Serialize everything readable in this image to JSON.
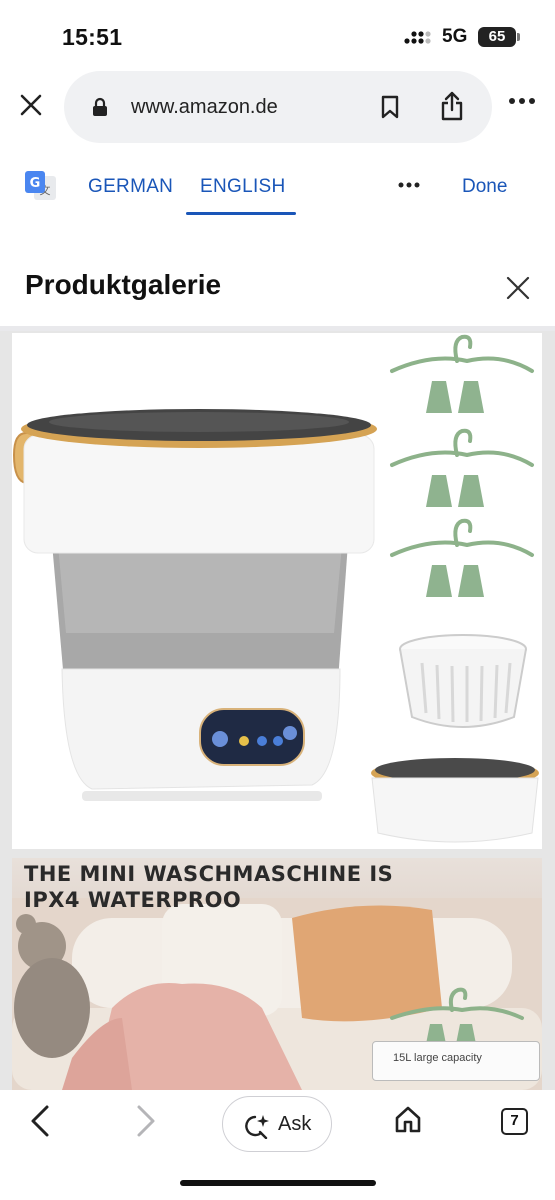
{
  "status_bar": {
    "time": "15:51",
    "network": "5G",
    "battery": "65",
    "icons": [
      "signal-icon",
      "battery-icon"
    ]
  },
  "browser": {
    "url": "www.amazon.de",
    "icons": [
      "close-icon",
      "lock-icon",
      "bookmark-icon",
      "share-icon",
      "more-icon"
    ]
  },
  "translate": {
    "source_lang": "GERMAN",
    "target_lang": "ENGLISH",
    "done_label": "Done",
    "active_tab": "ENGLISH",
    "accent_color": "#1a56b8",
    "icons": [
      "google-translate-icon",
      "more-icon"
    ]
  },
  "gallery": {
    "title": "Produktgalerie",
    "images": [
      {
        "alt": ""
      },
      {
        "heading_line1": "THE MINI WASCHMASCHINE IS",
        "heading_line2": "IPX4 WATERPROO",
        "capacity_label": "15L large capacity"
      }
    ],
    "icons": [
      "close-icon"
    ]
  },
  "toolbar": {
    "ask_label": "Ask",
    "tab_count": "7",
    "icons": [
      "back-icon",
      "forward-icon",
      "ask-sparkle-icon",
      "home-icon",
      "tabs-icon"
    ]
  }
}
